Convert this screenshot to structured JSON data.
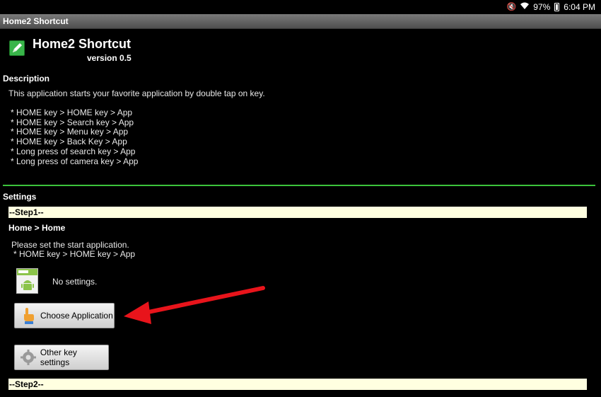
{
  "status_bar": {
    "battery": "97%",
    "time": "6:04 PM",
    "icons": [
      "mute-icon",
      "wifi-icon",
      "battery-icon"
    ]
  },
  "title_bar": {
    "title": "Home2 Shortcut"
  },
  "header": {
    "app_name": "Home2 Shortcut",
    "version": "version 0.5",
    "icon": "app-pen-icon"
  },
  "description": {
    "heading": "Description",
    "text": "This application starts your favorite application by double tap on key.",
    "items": [
      "* HOME key > HOME key > App",
      "* HOME key > Search key > App",
      "* HOME key > Menu key > App",
      "* HOME key > Back Key > App",
      "* Long press of search key > App",
      "* Long press of camera key > App"
    ]
  },
  "settings": {
    "heading": "Settings",
    "step1": {
      "label": "--Step1--",
      "route": "Home > Home",
      "prompt": "Please set the start application.",
      "prompt_sub": " * HOME key > HOME key > App",
      "current": "No settings.",
      "choose_button": "Choose Application",
      "other_button": "Other key settings"
    },
    "step2": {
      "label": "--Step2--"
    }
  },
  "colors": {
    "divider": "#3cc33c",
    "step_bar": "#ffffe0",
    "arrow": "#e8141b"
  }
}
